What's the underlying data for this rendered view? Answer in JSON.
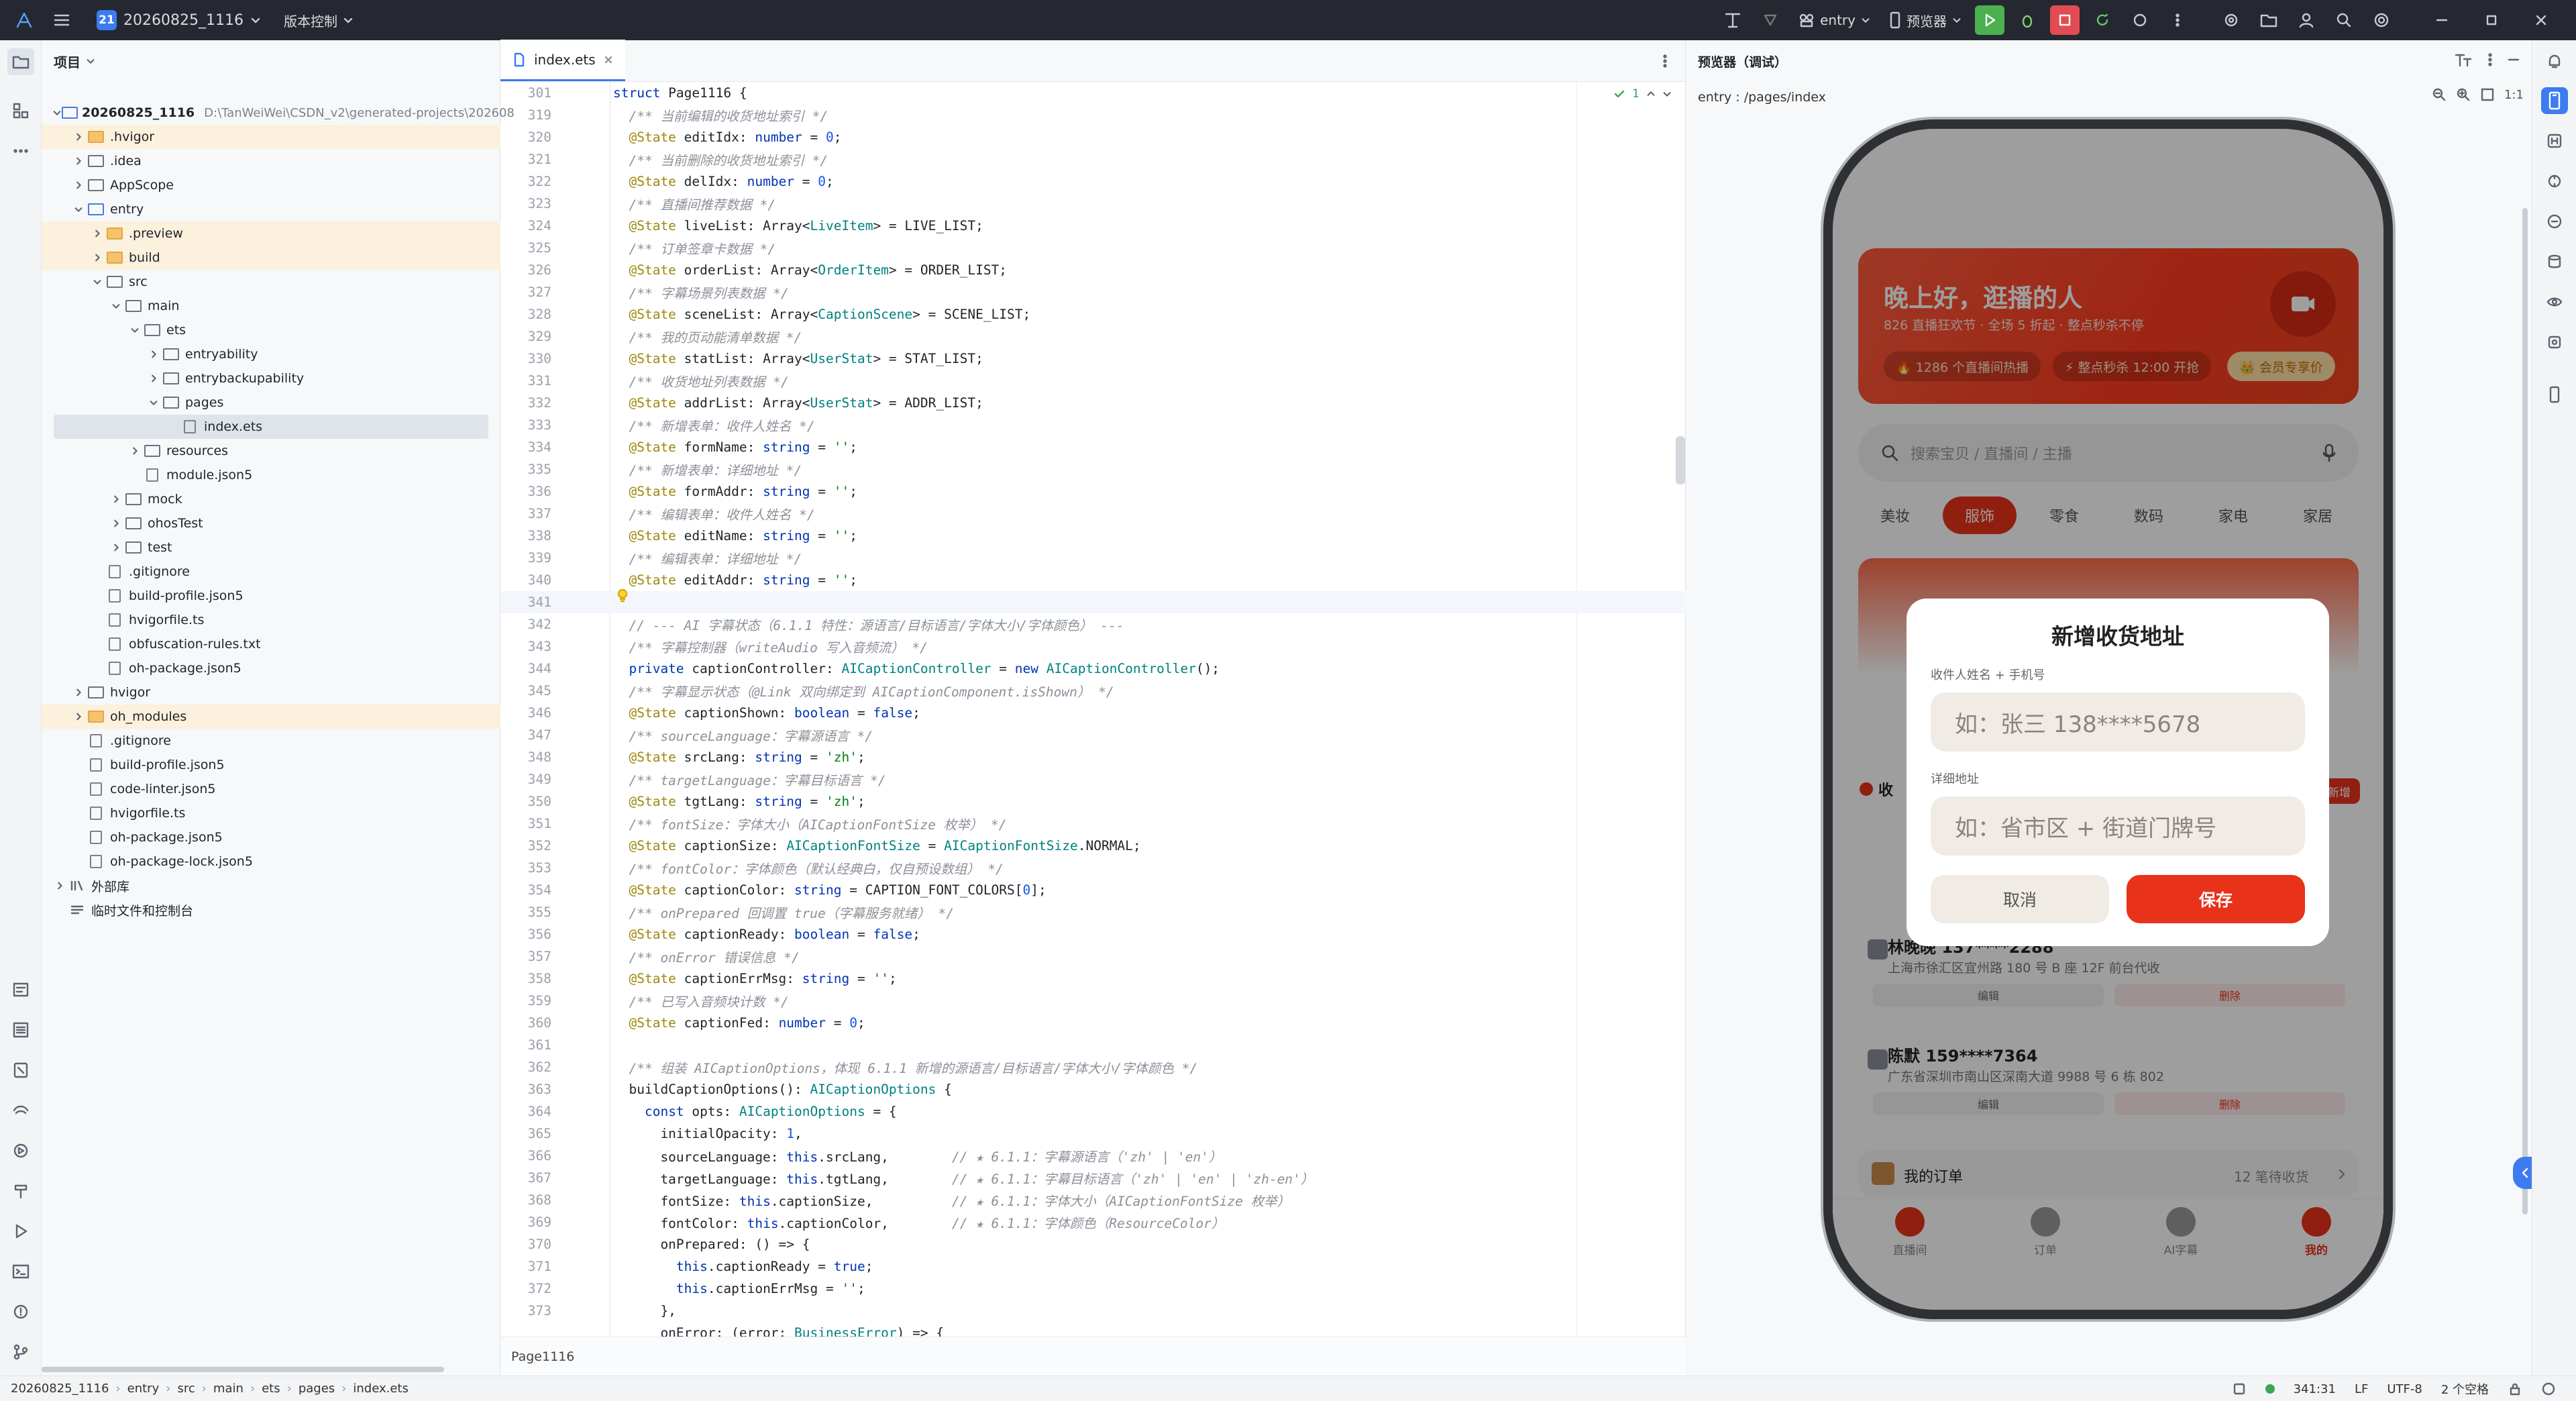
{
  "topbar": {
    "project_num": "21",
    "project_name": "20260825_1116",
    "vcs_label": "版本控制",
    "run_target": "entry",
    "device": "预览器"
  },
  "project_panel": {
    "title": "项目",
    "root_name": "20260825_1116",
    "root_path": "D:\\TanWeiWei\\CSDN_v2\\generated-projects\\202608",
    "items": [
      {
        "label": ".hvigor"
      },
      {
        "label": ".idea"
      },
      {
        "label": "AppScope"
      },
      {
        "label": "entry"
      },
      {
        "label": ".preview"
      },
      {
        "label": "build"
      },
      {
        "label": "src"
      },
      {
        "label": "main"
      },
      {
        "label": "ets"
      },
      {
        "label": "entryability"
      },
      {
        "label": "entrybackupability"
      },
      {
        "label": "pages"
      },
      {
        "label": "index.ets"
      },
      {
        "label": "resources"
      },
      {
        "label": "module.json5"
      },
      {
        "label": "mock"
      },
      {
        "label": "ohosTest"
      },
      {
        "label": "test"
      },
      {
        "label": ".gitignore"
      },
      {
        "label": "build-profile.json5"
      },
      {
        "label": "hvigorfile.ts"
      },
      {
        "label": "obfuscation-rules.txt"
      },
      {
        "label": "oh-package.json5"
      },
      {
        "label": "hvigor"
      },
      {
        "label": "oh_modules"
      },
      {
        "label": ".gitignore"
      },
      {
        "label": "build-profile.json5"
      },
      {
        "label": "code-linter.json5"
      },
      {
        "label": "hvigorfile.ts"
      },
      {
        "label": "oh-package.json5"
      },
      {
        "label": "oh-package-lock.json5"
      },
      {
        "label": "外部库"
      },
      {
        "label": "临时文件和控制台"
      }
    ]
  },
  "editor": {
    "tab_label": "index.ets",
    "inspection_count": "1",
    "breadcrumb": "Page1116",
    "line_numbers": [
      "301",
      "319",
      "320",
      "321",
      "322",
      "323",
      "324",
      "325",
      "326",
      "327",
      "328",
      "329",
      "330",
      "331",
      "332",
      "333",
      "334",
      "335",
      "336",
      "337",
      "338",
      "339",
      "340",
      "341",
      "342",
      "343",
      "344",
      "345",
      "346",
      "347",
      "348",
      "349",
      "350",
      "351",
      "352",
      "353",
      "354",
      "355",
      "356",
      "357",
      "358",
      "359",
      "360",
      "361",
      "362",
      "363",
      "364",
      "365",
      "366",
      "367",
      "368",
      "369",
      "370",
      "371",
      "372",
      "373"
    ],
    "lines": [
      "struct Page1116 {",
      "  /** 当前编辑的收货地址索引 */",
      "  @State editIdx: number = 0;",
      "  /** 当前删除的收货地址索引 */",
      "  @State delIdx: number = 0;",
      "  /** 直播间推荐数据 */",
      "  @State liveList: Array<LiveItem> = LIVE_LIST;",
      "  /** 订单签章卡数据 */",
      "  @State orderList: Array<OrderItem> = ORDER_LIST;",
      "  /** 字幕场景列表数据 */",
      "  @State sceneList: Array<CaptionScene> = SCENE_LIST;",
      "  /** 我的页动能清单数据 */",
      "  @State statList: Array<UserStat> = STAT_LIST;",
      "  /** 收货地址列表数据 */",
      "  @State addrList: Array<UserStat> = ADDR_LIST;",
      "  /** 新增表单：收件人姓名 */",
      "  @State formName: string = '';",
      "  /** 新增表单：详细地址 */",
      "  @State formAddr: string = '';",
      "  /** 编辑表单：收件人姓名 */",
      "  @State editName: string = '';",
      "  /** 编辑表单：详细地址 */",
      "  @State editAddr: string = '';",
      "",
      "  // --- AI 字幕状态（6.1.1 特性：源语言/目标语言/字体大小/字体颜色） ---",
      "  /** 字幕控制器（writeAudio 写入音频流） */",
      "  private captionController: AICaptionController = new AICaptionController();",
      "  /** 字幕显示状态（@Link 双向绑定到 AICaptionComponent.isShown） */",
      "  @State captionShown: boolean = false;",
      "  /** sourceLanguage：字幕源语言 */",
      "  @State srcLang: string = 'zh';",
      "  /** targetLanguage：字幕目标语言 */",
      "  @State tgtLang: string = 'zh';",
      "  /** fontSize：字体大小（AICaptionFontSize 枚举） */",
      "  @State captionSize: AICaptionFontSize = AICaptionFontSize.NORMAL;",
      "  /** fontColor：字体颜色（默认经典白，仅自预设数组） */",
      "  @State captionColor: string = CAPTION_FONT_COLORS[0];",
      "  /** onPrepared 回调置 true（字幕服务就绪） */",
      "  @State captionReady: boolean = false;",
      "  /** onError 错误信息 */",
      "  @State captionErrMsg: string = '';",
      "  /** 已写入音频块计数 */",
      "  @State captionFed: number = 0;",
      "",
      "  /** 组装 AICaptionOptions，体现 6.1.1 新增的源语言/目标语言/字体大小/字体颜色 */",
      "  buildCaptionOptions(): AICaptionOptions {",
      "    const opts: AICaptionOptions = {",
      "      initialOpacity: 1,",
      "      sourceLanguage: this.srcLang,        // ★ 6.1.1：字幕源语言（'zh' | 'en'）",
      "      targetLanguage: this.tgtLang,        // ★ 6.1.1：字幕目标语言（'zh' | 'en' | 'zh-en'）",
      "      fontSize: this.captionSize,          // ★ 6.1.1：字体大小（AICaptionFontSize 枚举）",
      "      fontColor: this.captionColor,        // ★ 6.1.1：字体颜色（ResourceColor）",
      "      onPrepared: () => {",
      "        this.captionReady = true;",
      "        this.captionErrMsg = '';",
      "      },",
      "      onError: (error: BusinessError) => {"
    ]
  },
  "previewer": {
    "title": "预览器（调试）",
    "route": "entry : /pages/index",
    "app": {
      "greeting": "晚上好，逛播的人",
      "subtitle": "826 直播狂欢节 · 全场 5 折起 · 整点秒杀不停",
      "pill_1": "🔥 1286 个直播间热播",
      "pill_2": "⚡ 整点秒杀 12:00 开抢",
      "pill_3": "👑 会员专享价",
      "search_placeholder": "搜索宝贝 / 直播间 / 主播",
      "categories": [
        "美妆",
        "服饰",
        "零食",
        "数码",
        "家电",
        "家居"
      ],
      "addresses": [
        {
          "name": "林晚晚 137****2288",
          "line": "上海市徐汇区宜州路 180 号 B 座 12F 前台代收"
        },
        {
          "name": "陈默 159****7364",
          "line": "广东省深圳市南山区深南大道 9988 号 6 栋 802"
        }
      ],
      "edit_label": "编辑",
      "delete_label": "删除",
      "new_tag": "新增",
      "section_prefix": "收",
      "orders_label": "我的订单",
      "orders_count": "12 笔待收货",
      "tabs": [
        "直播间",
        "订单",
        "AI字幕",
        "我的"
      ]
    },
    "dialog": {
      "title": "新增收货地址",
      "name_label": "收件人姓名 + 手机号",
      "name_placeholder": "如：张三 138****5678",
      "addr_label": "详细地址",
      "addr_placeholder": "如：省市区 + 街道门牌号",
      "cancel": "取消",
      "save": "保存"
    }
  },
  "statusbar": {
    "crumbs": [
      "20260825_1116",
      "entry",
      "src",
      "main",
      "ets",
      "pages",
      "index.ets"
    ],
    "position": "341:31",
    "line_sep": "LF",
    "encoding": "UTF-8",
    "indent": "2 个空格"
  },
  "colors": {
    "accent": "#3d7bf0",
    "brand_red": "#e8321a",
    "folder_highlight": "#fbf1dc"
  }
}
